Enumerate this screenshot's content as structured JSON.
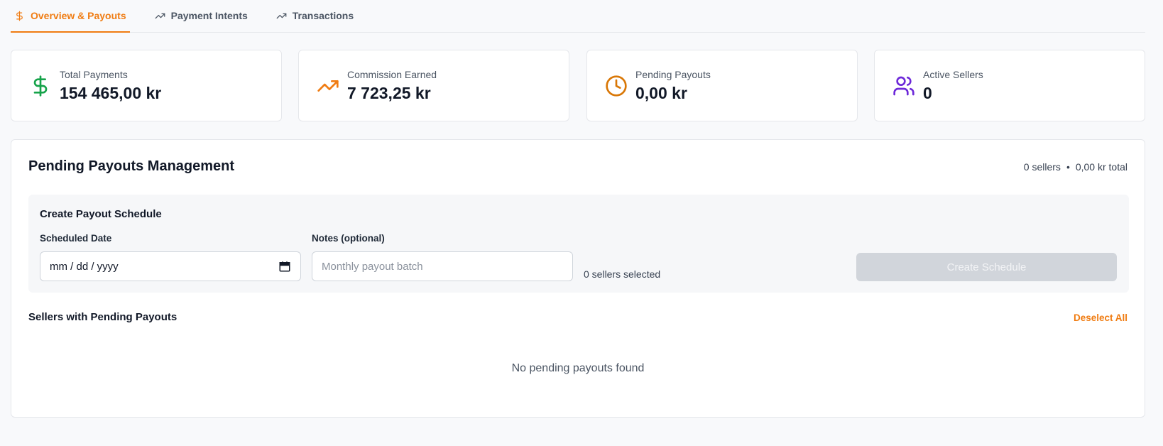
{
  "tabs": [
    {
      "label": "Overview & Payouts",
      "icon": "dollar-icon",
      "active": true
    },
    {
      "label": "Payment Intents",
      "icon": "trending-up-icon",
      "active": false
    },
    {
      "label": "Transactions",
      "icon": "trending-up-icon",
      "active": false
    }
  ],
  "stats": [
    {
      "label": "Total Payments",
      "value": "154 465,00 kr",
      "icon": "dollar-icon",
      "color": "#16a34a"
    },
    {
      "label": "Commission Earned",
      "value": "7 723,25 kr",
      "icon": "trending-up-icon",
      "color": "#f07c12"
    },
    {
      "label": "Pending Payouts",
      "value": "0,00 kr",
      "icon": "clock-icon",
      "color": "#d97706"
    },
    {
      "label": "Active Sellers",
      "value": "0",
      "icon": "users-icon",
      "color": "#6d28d9"
    }
  ],
  "panel": {
    "title": "Pending Payouts Management",
    "summary_sellers": "0 sellers",
    "summary_separator": "•",
    "summary_total": "0,00 kr total"
  },
  "schedule": {
    "title": "Create Payout Schedule",
    "date_label": "Scheduled Date",
    "date_value": "mm / dd / yyyy",
    "notes_label": "Notes (optional)",
    "notes_placeholder": "Monthly payout batch",
    "selected_count": "0 sellers selected",
    "create_label": "Create Schedule"
  },
  "sellers": {
    "title": "Sellers with Pending Payouts",
    "deselect_label": "Deselect All",
    "empty_message": "No pending payouts found"
  },
  "colors": {
    "accent": "#f07c12",
    "button_disabled": "#d1d5db"
  }
}
